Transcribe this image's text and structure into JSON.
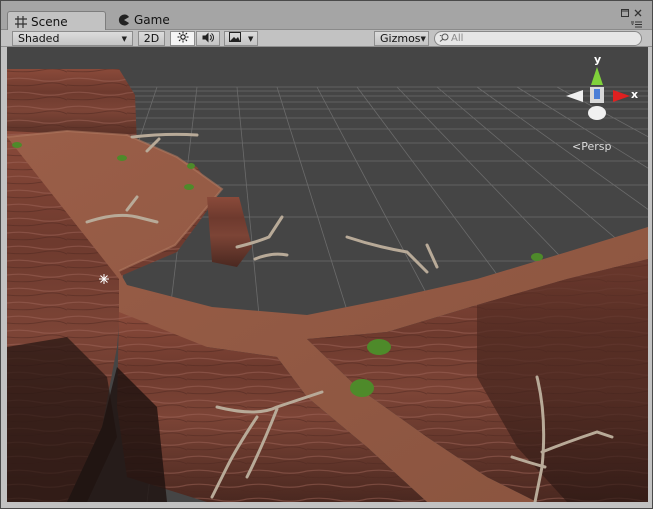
{
  "tabs": [
    {
      "label": "Scene",
      "icon": "scene-grid-icon",
      "active": true
    },
    {
      "label": "Game",
      "icon": "game-pacman-icon",
      "active": false
    }
  ],
  "toolbar": {
    "shading_mode": "Shaded",
    "mode_2d": "2D",
    "lighting_icon": "sun-icon",
    "audio_icon": "speaker-icon",
    "effects_icon": "image-icon",
    "gizmos_label": "Gizmos",
    "search_placeholder": "All"
  },
  "viewport": {
    "camera_projection": "Persp",
    "axis_labels": {
      "y": "y",
      "x": "x"
    },
    "colors": {
      "sky": "#454545",
      "grid": "#6b6b6b",
      "rock": "#8a5040",
      "axis_y": "#7fd23a",
      "axis_x": "#e02020"
    }
  }
}
